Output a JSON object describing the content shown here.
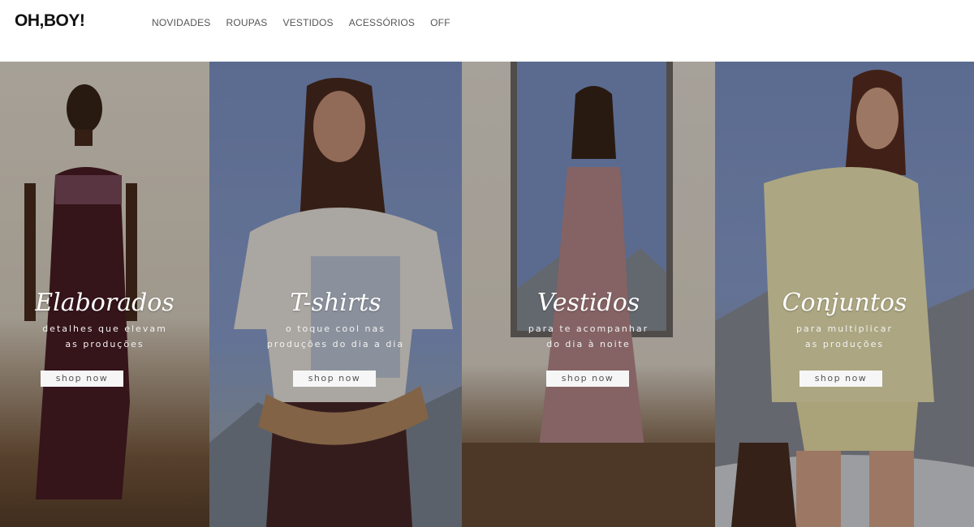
{
  "header": {
    "logo": "OH,BOY!",
    "nav": [
      "NOVIDADES",
      "ROUPAS",
      "VESTIDOS",
      "ACESSÓRIOS",
      "OFF"
    ]
  },
  "panels": [
    {
      "title": "Elaborados",
      "sub1": "detalhes que elevam",
      "sub2": "as produções",
      "button": "shop now"
    },
    {
      "title": "T-shirts",
      "sub1": "o toque cool nas",
      "sub2": "produções do dia a dia",
      "button": "shop now"
    },
    {
      "title": "Vestidos",
      "sub1": "para te acompanhar",
      "sub2": "do dia à noite",
      "button": "shop now"
    },
    {
      "title": "Conjuntos",
      "sub1": "para multiplicar",
      "sub2": "as produções",
      "button": "shop now"
    }
  ],
  "colors": {
    "sky_blue": "#7f95c8",
    "beige_wall": "#e6dfd4",
    "button_bg": "#f6f6f6"
  }
}
